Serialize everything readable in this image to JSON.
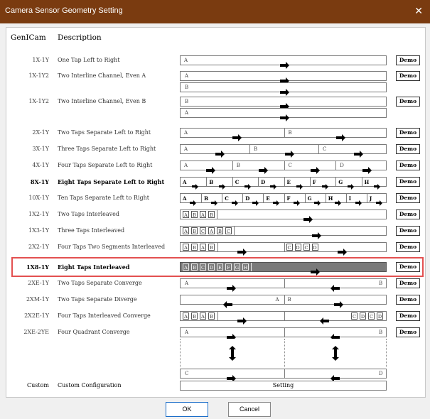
{
  "window": {
    "title": "Camera Sensor Geometry Setting",
    "close_label": "✕"
  },
  "headers": {
    "code": "GenICam",
    "description": "Description"
  },
  "rows": [
    {
      "code": "1X-1Y",
      "desc": "One Tap Left to Right",
      "labels": [
        "A"
      ],
      "demo": "Demo"
    },
    {
      "code": "1X-1Y2",
      "desc": "Two Interline Channel, Even A",
      "labels": [
        "A",
        "B"
      ],
      "demo": "Demo"
    },
    {
      "code": "1X-1Y2",
      "desc": "Two Interline Channel, Even B",
      "labels": [
        "B",
        "A"
      ],
      "demo": "Demo"
    },
    {
      "code": "2X-1Y",
      "desc": "Two Taps Separate Left to Right",
      "labels": [
        "A",
        "B"
      ],
      "demo": "Demo"
    },
    {
      "code": "3X-1Y",
      "desc": "Three Taps Separate Left to Right",
      "labels": [
        "A",
        "B",
        "C"
      ],
      "demo": "Demo"
    },
    {
      "code": "4X-1Y",
      "desc": "Four Taps Separate Left to Right",
      "labels": [
        "A",
        "B",
        "C",
        "D"
      ],
      "demo": "Demo"
    },
    {
      "code": "8X-1Y",
      "desc": "Eight Taps Separate Left to Right",
      "labels": [
        "A",
        "B",
        "C",
        "D",
        "E",
        "F",
        "G",
        "H"
      ],
      "demo": "Demo"
    },
    {
      "code": "10X-1Y",
      "desc": "Ten Taps Separate Left to Right",
      "labels": [
        "A",
        "B",
        "C",
        "D",
        "E",
        "F",
        "G",
        "H",
        "I",
        "J"
      ],
      "demo": "Demo"
    },
    {
      "code": "1X2-1Y",
      "desc": "Two Taps Interleaved",
      "labels": [
        "A",
        "B",
        "A",
        "B"
      ],
      "demo": "Demo"
    },
    {
      "code": "1X3-1Y",
      "desc": "Three Taps Interleaved",
      "labels": [
        "A",
        "B",
        "C",
        "A",
        "B",
        "C"
      ],
      "demo": "Demo"
    },
    {
      "code": "2X2-1Y",
      "desc": "Four Taps Two Segments Interleaved",
      "labels": [
        "A",
        "B",
        "A",
        "B",
        "C",
        "D",
        "C",
        "D"
      ],
      "demo": "Demo"
    },
    {
      "code": "1X8-1Y",
      "desc": "Eight Taps Interleaved",
      "labels": [
        "A",
        "B",
        "C",
        "D",
        "E",
        "F",
        "G",
        "H"
      ],
      "demo": "Demo"
    },
    {
      "code": "2XE-1Y",
      "desc": "Two Taps Separate Converge",
      "labels": [
        "A",
        "B"
      ],
      "demo": "Demo"
    },
    {
      "code": "2XM-1Y",
      "desc": "Two Taps Separate Diverge",
      "labels": [
        "A",
        "B"
      ],
      "demo": "Demo"
    },
    {
      "code": "2X2E-1Y",
      "desc": "Four Taps Interleaved Converge",
      "labels": [
        "A",
        "B",
        "A",
        "B",
        "C",
        "D",
        "C",
        "D"
      ],
      "demo": "Demo"
    },
    {
      "code": "2XE-2YE",
      "desc": "Four Quadrant Converge",
      "labels": [
        "A",
        "B",
        "C",
        "D"
      ],
      "demo": "Demo"
    }
  ],
  "custom": {
    "code": "Custom",
    "desc": "Custom Configuration",
    "setting": "Setting"
  },
  "buttons": {
    "ok": "OK",
    "cancel": "Cancel"
  },
  "selected_row": "1X8-1Y",
  "colors": {
    "titlebar": "#7a3b10",
    "selection": "#e35050",
    "dark_strip": "#7a7a7a"
  }
}
